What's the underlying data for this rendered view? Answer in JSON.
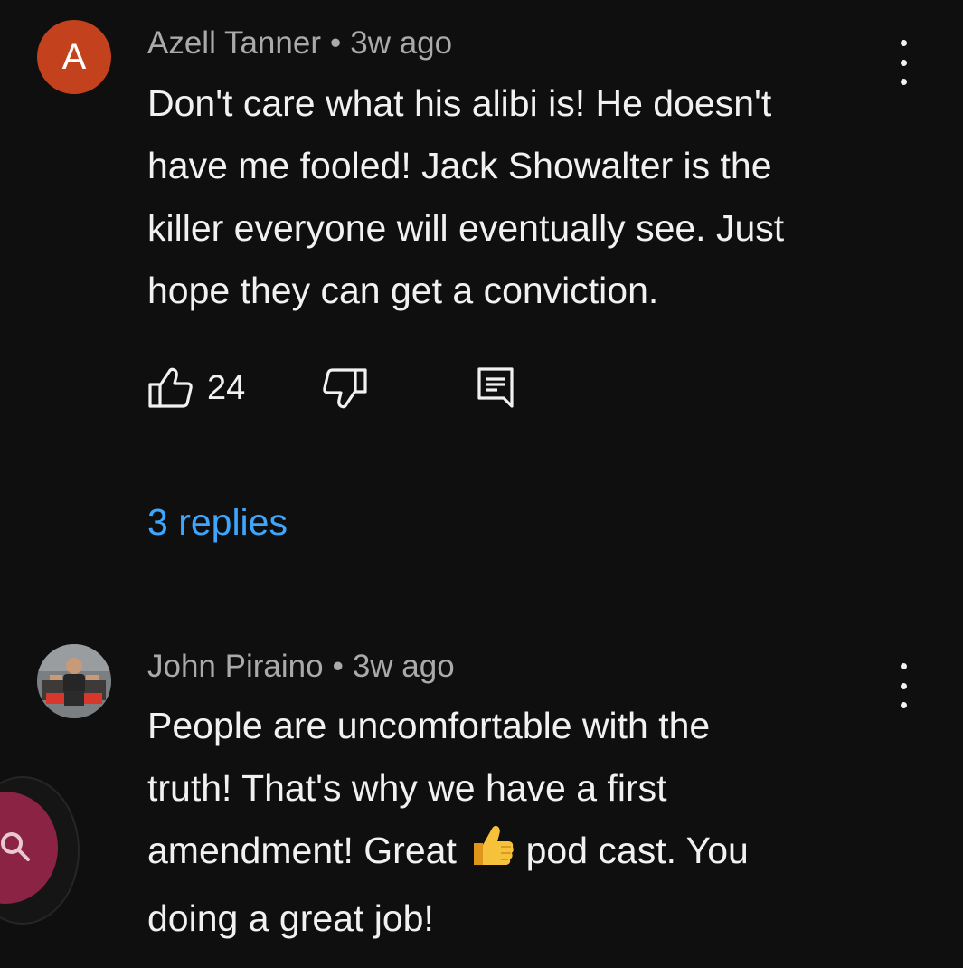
{
  "comments": [
    {
      "author": "Azell Tanner",
      "separator": "•",
      "time": "3w ago",
      "avatar_letter": "A",
      "text": "Don't care what his alibi is! He doesn't\nhave me fooled! Jack Showalter is the\nkiller everyone will eventually see. Just\nhope they can get a conviction.",
      "likes": "24",
      "replies": "3 replies"
    },
    {
      "author": "John Piraino",
      "separator": "•",
      "time": "3w ago",
      "text_before_emoji": "People are uncomfortable with the\ntruth! That's why we have a first\namendment! Great ",
      "emoji": "thumbs-up-emoji",
      "text_after_emoji": " pod cast. You\ndoing a great job!"
    }
  ],
  "icons": {
    "like": "thumbs-up-icon",
    "dislike": "thumbs-down-icon",
    "reply": "reply-comment-icon",
    "menu": "more-vertical-icon",
    "fab": "search-icon"
  },
  "colors": {
    "background": "#0f0f0f",
    "text": "#f1f1f1",
    "meta": "#aaaaaa",
    "link": "#3ea6ff",
    "avatar_a": "#c4411d",
    "fab": "#8a2344"
  }
}
